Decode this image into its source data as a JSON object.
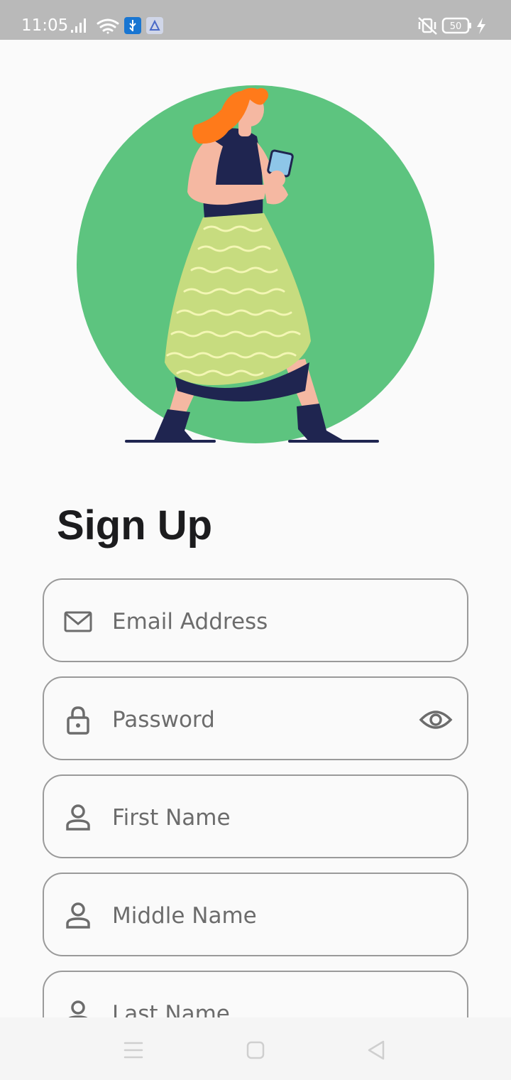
{
  "status_bar": {
    "time": "11:05",
    "battery": "50",
    "icons": [
      "signal-icon",
      "wifi-icon",
      "usb-debug-icon",
      "app-notification-icon",
      "vibrate-off-icon",
      "battery-icon",
      "charging-icon"
    ],
    "background": "#b9b9b9"
  },
  "illustration": {
    "subject": "woman-walking-with-phone-illustration",
    "circle_color": "#5dc47f"
  },
  "page": {
    "title": "Sign Up"
  },
  "form": {
    "email": {
      "placeholder": "Email Address",
      "value": "",
      "icon": "mail-icon"
    },
    "password": {
      "placeholder": "Password",
      "value": "",
      "icon": "lock-icon",
      "toggle_icon": "eye-icon"
    },
    "first_name": {
      "placeholder": "First Name",
      "value": "",
      "icon": "person-icon"
    },
    "middle_name": {
      "placeholder": "Middle Name",
      "value": "",
      "icon": "person-icon"
    },
    "last_name": {
      "placeholder": "Last Name",
      "value": "",
      "icon": "person-icon"
    }
  },
  "nav_bar": {
    "buttons": [
      "menu-icon",
      "home-square-icon",
      "back-triangle-icon"
    ]
  }
}
